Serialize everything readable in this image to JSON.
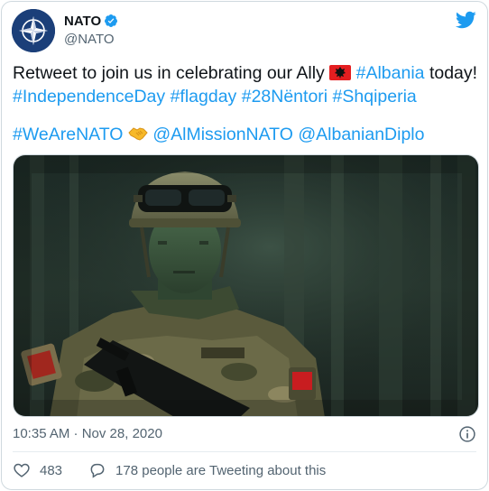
{
  "author": {
    "display_name": "NATO",
    "handle": "@NATO",
    "avatar_icon": "nato-compass-icon",
    "verified_icon": "verified-badge-icon"
  },
  "brand": {
    "logo_icon": "twitter-bird-icon",
    "accent": "#1d9bf0"
  },
  "tweet": {
    "line1_prefix": "Retweet to join us in celebrating our Ally ",
    "flag_icon": "albania-flag-icon",
    "hashtag_albania": "#Albania",
    "line1_suffix": " today!",
    "hashtag_independence": "#IndependenceDay",
    "hashtag_flagday": "#flagday",
    "hashtag_28nentori": "#28Nëntori",
    "hashtag_shqiperia": "#Shqiperia",
    "hashtag_wearenato": "#WeAreNATO",
    "handshake_icon": "handshake-icon",
    "mention_almission": "@AlMissionNATO",
    "mention_albaniandiplo": "@AlbanianDiplo"
  },
  "media": {
    "icon": "soldier-photo"
  },
  "meta": {
    "timestamp": "10:35 AM · Nov 28, 2020",
    "info_icon": "info-icon"
  },
  "actions": {
    "like_count": "483",
    "like_icon": "heart-icon",
    "reply_icon": "speech-bubble-icon",
    "reply_label": "178 people are Tweeting about this"
  }
}
